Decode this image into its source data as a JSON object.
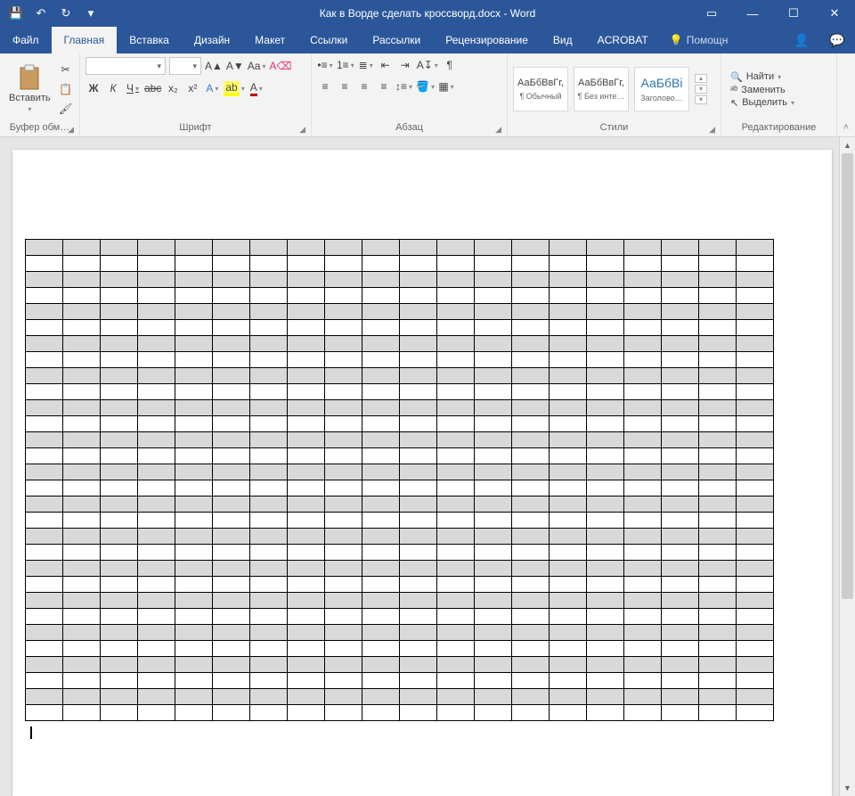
{
  "title": "Как в Ворде сделать кроссворд.docx - Word",
  "qat": {
    "save": "💾",
    "undo": "↶",
    "redo": "↻",
    "custom": "▾"
  },
  "tabs": [
    "Файл",
    "Главная",
    "Вставка",
    "Дизайн",
    "Макет",
    "Ссылки",
    "Рассылки",
    "Рецензирование",
    "Вид",
    "ACROBAT"
  ],
  "active_tab": 1,
  "tellme": "Помощн",
  "ribbon": {
    "clipboard": {
      "paste": "Вставить",
      "label": "Буфер обм…"
    },
    "font": {
      "font_name": "",
      "font_size": "",
      "label": "Шрифт",
      "bold": "Ж",
      "italic": "К",
      "underline": "Ч",
      "strike": "abc",
      "sub": "x₂",
      "sup": "x²",
      "clearfmt": "Aₐ",
      "case": "Aa"
    },
    "paragraph": {
      "label": "Абзац"
    },
    "styles": {
      "label": "Стили",
      "cards": [
        {
          "preview": "АаБбВвГг,",
          "name": "¶ Обычный"
        },
        {
          "preview": "АаБбВвГг,",
          "name": "¶ Без инте…"
        },
        {
          "preview": "АаБбВі",
          "name": "Заголово…",
          "accent": true
        }
      ]
    },
    "editing": {
      "label": "Редактирование",
      "find": "Найти",
      "replace": "Заменить",
      "select": "Выделить"
    }
  },
  "windowbtns": {
    "ribopts": "▭",
    "min": "—",
    "max": "☐",
    "close": "✕"
  },
  "crossword": {
    "rows": 30,
    "cols": 20,
    "shade_every": 2
  }
}
